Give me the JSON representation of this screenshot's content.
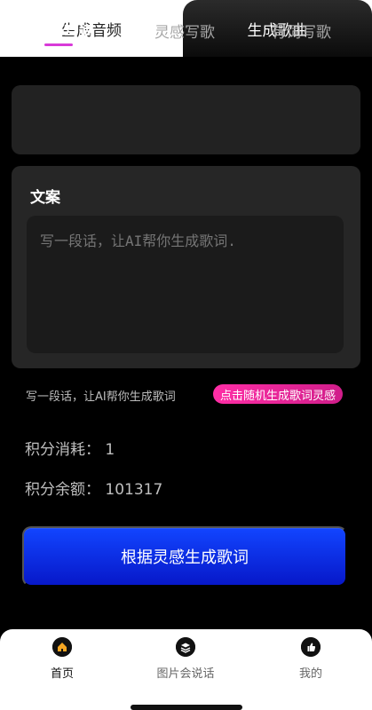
{
  "tabs": {
    "left": "生成音频",
    "right": "生成歌曲"
  },
  "modes": [
    {
      "label": "AI写词"
    },
    {
      "label": "灵感写歌"
    },
    {
      "label": "有词写歌"
    }
  ],
  "copy": {
    "title": "文案",
    "placeholder": "写一段话，让AI帮你生成歌词."
  },
  "hint": {
    "text": "写一段话，让AI帮你生成歌词",
    "random_label": "点击随机生成歌词灵感"
  },
  "stats": {
    "cost": "积分消耗： 1",
    "balance": "积分余额： 101317"
  },
  "cta": {
    "label": "根据灵感生成歌词"
  },
  "nav": [
    {
      "label": "首页"
    },
    {
      "label": "图片会说话"
    },
    {
      "label": "我的"
    }
  ],
  "icons": {
    "home": "home-icon",
    "picture": "layers-icon",
    "me": "thumbs-up-icon"
  },
  "colors": {
    "accent_pink": "#d83ad8",
    "cta_blue": "#1245ff"
  }
}
